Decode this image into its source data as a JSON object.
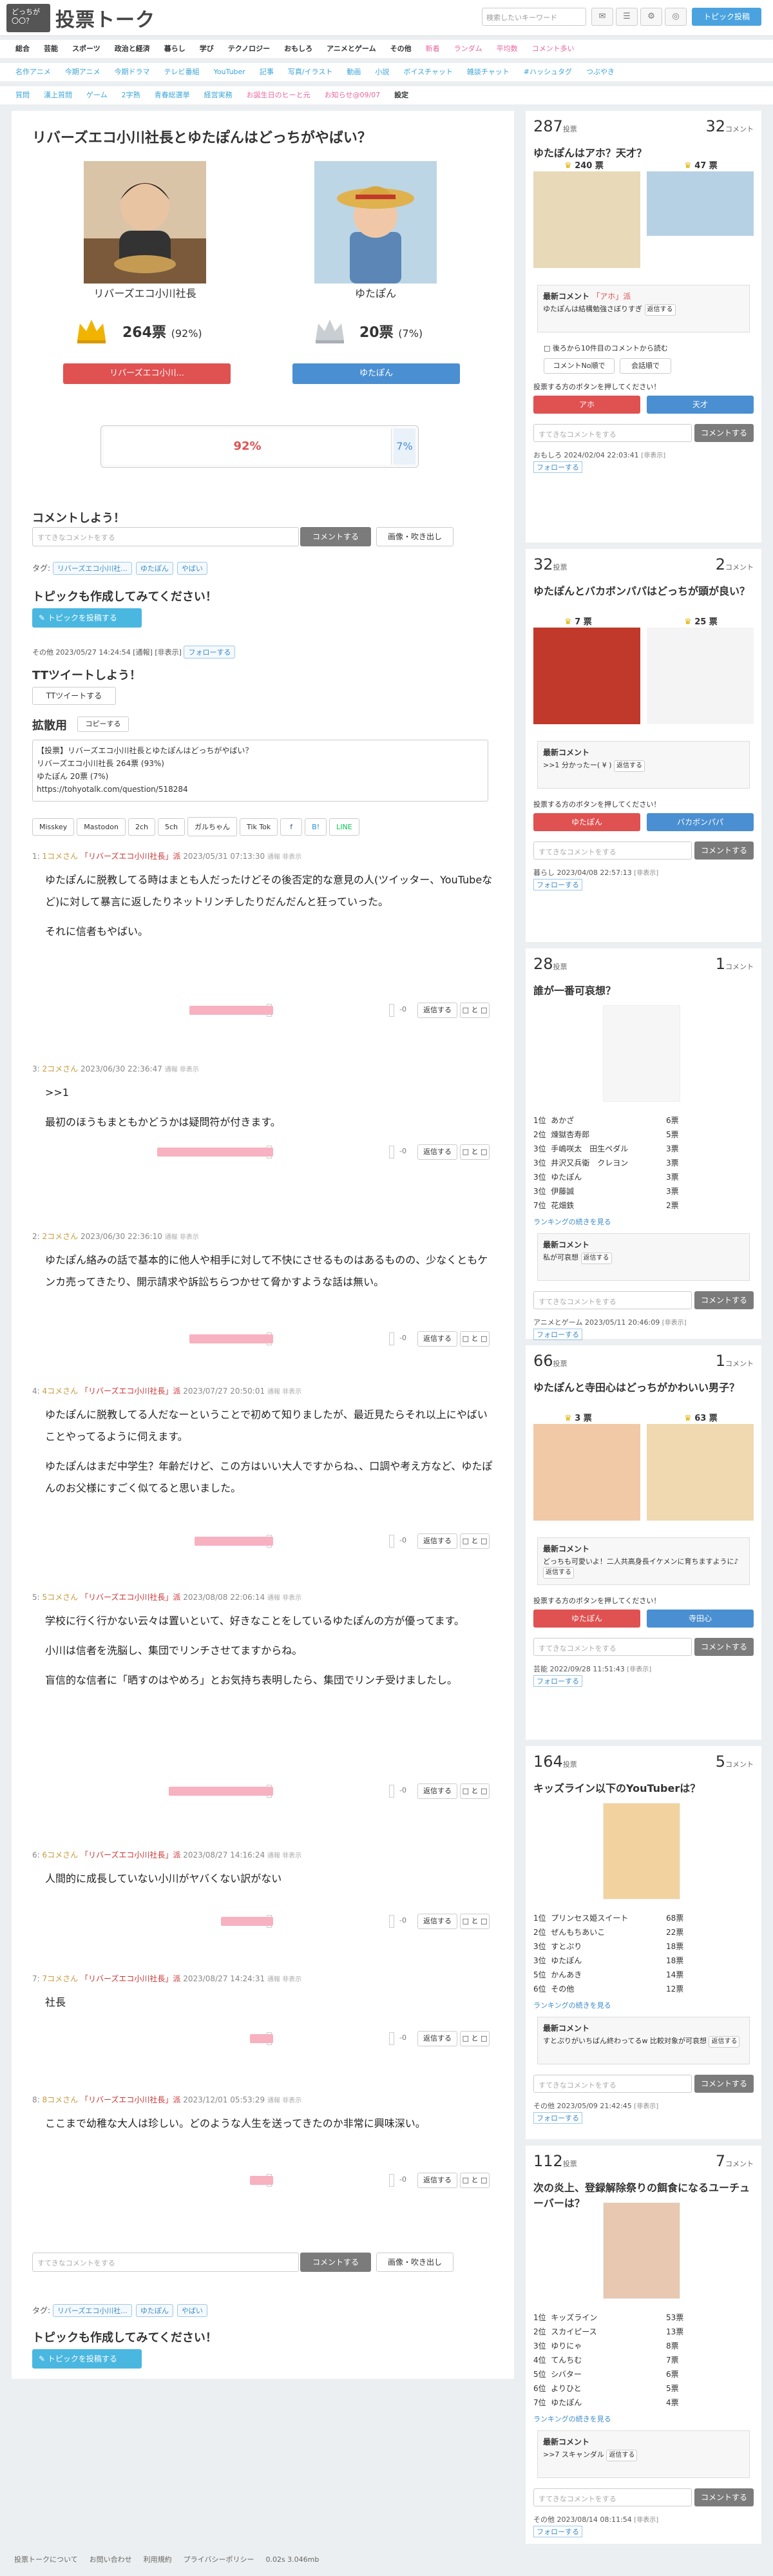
{
  "header": {
    "logo_line1": "どっちが",
    "logo_line2": "〇〇？",
    "logo_text": "投票トーク",
    "search_placeholder": "検索したいキーワード",
    "icon1": "✉",
    "icon2": "☰",
    "icon3": "⚙",
    "icon4": "◎",
    "post_label": "トピック投稿"
  },
  "nav1": [
    "総合",
    "芸能",
    "スポーツ",
    "政治と経済",
    "暮らし",
    "学び",
    "テクノロジー",
    "おもしろ",
    "アニメとゲーム",
    "その他",
    "新着",
    "ランダム",
    "平均数",
    "コメント多い"
  ],
  "nav2": [
    "名作アニメ",
    "今期アニメ",
    "今期ドラマ",
    "テレビ番組",
    "YouTuber",
    "記事",
    "写真/イラスト",
    "動画",
    "小説",
    "ボイスチャット",
    "雑談チャット",
    "#ハッシュタグ",
    "つぶやき"
  ],
  "nav3": [
    "質問",
    "漢上質問",
    "ゲーム",
    "2字熟",
    "青春総選挙",
    "経営実務",
    "お誕生日のヒーと元",
    "お知らせ@09/07",
    "設定"
  ],
  "topic": {
    "title": "リバーズエコ小川社長とゆたぽんはどっちがやばい？",
    "opt_a_name": "リバーズエコ小川社長",
    "opt_b_name": "ゆたぽん",
    "opt_a_votes": "264票",
    "opt_a_pct": "(92%)",
    "opt_b_votes": "20票",
    "opt_b_pct": "(7%)",
    "opt_a_btn": "リバーズエコ小川...",
    "opt_b_btn": "ゆたぽん",
    "bar_a_pct": 92,
    "bar_b_pct": 7,
    "bar_a_label": "92%",
    "bar_b_label": "7%",
    "comment_heading": "コメントしよう！",
    "comment_placeholder": "すてきなコメントをする",
    "comment_btn": "コメントする",
    "image_btn": "画像・吹き出し",
    "tags_label": "タグ:",
    "tags": [
      "リバーズエコ小川社...",
      "ゆたぽん",
      "やばい"
    ],
    "create_heading": "トピックも作成してみてください！",
    "create_btn": "トピックを投稿する",
    "info": "その他  2023/05/27 14:24:54  [通報] [非表示]",
    "follow": "フォローする",
    "tweet_heading": "TTツイートしよう！",
    "tweet_btn": "TTツイートする",
    "spread_heading": "拡散用",
    "copy_btn": "コピーする",
    "spread_text_1": "【投票】リバーズエコ小川社長とゆたぽんはどっちがやばい？",
    "spread_text_2": "リバーズエコ小川社長 264票 (93%)",
    "spread_text_3": "ゆたぽん 20票 (7%)",
    "spread_text_4": "https://tohyotalk.com/question/518284",
    "share": [
      "Misskey",
      "Mastodon",
      "2ch",
      "5ch",
      "ガルちゃん",
      "Tik Tok",
      "",
      "B!",
      "LINE"
    ]
  },
  "comments": [
    {
      "no": "1:",
      "name": "1コメさん",
      "vote": "「リバーズエコ小川社長」派",
      "date": "2023/05/31 07:13:30",
      "small": "通報 非表示",
      "body1": "ゆたぽんに脱教してる時はまとも人だったけどその後否定的な意見の人(ツイッター、YouTubeなど)に対して暴言に返したりネットリンチしたりだんだんと狂っていった。",
      "body2": "それに信者もやばい。",
      "plus": "+18",
      "minus": "-0",
      "pink": 0.72,
      "reply": "返信する",
      "more": "□ と □"
    },
    {
      "no": "3:",
      "name": "2コメさん",
      "vote": "",
      "date": "2023/06/30 22:36:47",
      "small": "通報 非表示",
      "body1": ">>1",
      "body2": "最初のほうもまともかどうかは疑問符が付きます。",
      "plus": "+26",
      "minus": "-0",
      "pink": 1.0,
      "reply": "返信する",
      "more": "□ と □"
    },
    {
      "no": "2:",
      "name": "2コメさん",
      "vote": "",
      "date": "2023/06/30 22:36:10",
      "small": "通報 非表示",
      "body1": "ゆたぽん絡みの話で基本的に他人や相手に対して不快にさせるものはあるものの、少なくともケンカ売ってきたり、開示請求や訴訟ちらつかせて脅かすような話は無い。",
      "body2": "",
      "plus": "+18",
      "minus": "-0",
      "pink": 0.72,
      "reply": "返信する",
      "more": "□ と □"
    },
    {
      "no": "4:",
      "name": "4コメさん",
      "vote": "「リバーズエコ小川社長」派",
      "date": "2023/07/27 20:50:01",
      "small": "通報 非表示",
      "body1": "ゆたぽんに脱教してる人だなーということで初めて知りましたが、最近見たらそれ以上にやばいことやってるように伺えます。",
      "body2": "ゆたぽんはまだ中学生？年齢だけど、この方はいい大人ですからね、、口調や考え方など、ゆたぽんのお父様にすごく似てると思いました。",
      "plus": "+17",
      "minus": "-0",
      "pink": 0.68,
      "reply": "返信する",
      "more": "□ と □"
    },
    {
      "no": "5:",
      "name": "5コメさん",
      "vote": "「リバーズエコ小川社長」派",
      "date": "2023/08/08 22:06:14",
      "small": "通報 非表示",
      "body1": "学校に行く行かない云々は置いといて、好きなことをしているゆたぽんの方が優ってます。",
      "body2": "小川は信者を洗脳し、集団でリンチさせてますからね。",
      "body3": "盲信的な信者に「晒すのはやめろ」とお気持ち表明したら、集団でリンチ受けましたし。",
      "plus": "+22",
      "minus": "-0",
      "pink": 0.9,
      "reply": "返信する",
      "more": "□ と □"
    },
    {
      "no": "6:",
      "name": "6コメさん",
      "vote": "「リバーズエコ小川社長」派",
      "date": "2023/08/27 14:16:24",
      "small": "通報 非表示",
      "body1": "人間的に成長していない小川がヤバくない訳がない",
      "body2": "",
      "plus": "+11",
      "minus": "-0",
      "pink": 0.45,
      "reply": "返信する",
      "more": "□ と □"
    },
    {
      "no": "7:",
      "name": "7コメさん",
      "vote": "「リバーズエコ小川社長」派",
      "date": "2023/08/27 14:24:31",
      "small": "通報 非表示",
      "body1": "社長",
      "body2": "",
      "plus": "+5",
      "minus": "-0",
      "pink": 0.2,
      "reply": "返信する",
      "more": "□ と □"
    },
    {
      "no": "8:",
      "name": "8コメさん",
      "vote": "「リバーズエコ小川社長」派",
      "date": "2023/12/01 05:53:29",
      "small": "通報 非表示",
      "body1": "ここまで幼稚な大人は珍しい。どのような人生を送ってきたのか非常に興味深い。",
      "body2": "",
      "plus": "+5",
      "minus": "-0",
      "pink": 0.2,
      "reply": "返信する",
      "more": "□ と □"
    }
  ],
  "bottom": {
    "comment_placeholder": "すてきなコメントをする",
    "comment_btn": "コメントする",
    "image_btn": "画像・吹き出し",
    "tags_label": "タグ:",
    "tags": [
      "リバーズエコ小川社...",
      "ゆたぽん",
      "やばい"
    ],
    "create_heading": "トピックも作成してみてください！",
    "create_btn": "トピックを投稿する"
  },
  "sidebar": [
    {
      "votes": "287",
      "votes_unit": "投票",
      "comments": "32",
      "comments_unit": "コメント",
      "title": "ゆたぽんはアホ？天才？",
      "a_votes": "240 票",
      "b_votes": "47 票",
      "latest_label": "最新コメント",
      "latest_vote": "「アホ」派",
      "latest_text": "ゆたぽんは結構勉強さぼりすぎ",
      "reply": "返信する",
      "check_label": "後ろから10件目のコメントから読む",
      "c_btn": "コメントNo順で",
      "c_btn2": "会話順で",
      "prompt": "投票する方のボタンを押してください！",
      "btn_a": "アホ",
      "btn_b": "天才",
      "input": "すてきなコメントをする",
      "cbtn": "コメントする",
      "info": "おもしろ  2024/02/04 22:03:41",
      "follow": "フォローする"
    },
    {
      "votes": "32",
      "votes_unit": "投票",
      "comments": "2",
      "comments_unit": "コメント",
      "title": "ゆたぽんとバカボンパパはどっちが頭が良い？",
      "a_votes": "7 票",
      "b_votes": "25 票",
      "latest_label": "最新コメント",
      "latest_text": ">>1 分かったー( ¥ )",
      "reply": "返信する",
      "prompt": "投票する方のボタンを押してください！",
      "btn_a": "ゆたぽん",
      "btn_b": "バカボンパパ",
      "input": "すてきなコメントをする",
      "cbtn": "コメントする",
      "info": "暮らし  2023/04/08 22:57:13",
      "follow": "フォローする"
    },
    {
      "votes": "28",
      "votes_unit": "投票",
      "comments": "1",
      "comments_unit": "コメント",
      "title": "誰が一番可哀想？",
      "ranks": [
        [
          "1位",
          "あかざ",
          "6票"
        ],
        [
          "2位",
          "煉獄杏寿郎",
          "5票"
        ],
        [
          "3位",
          "手嶋咲太　田生ペダル",
          "3票"
        ],
        [
          "3位",
          "井沢又兵衛　クレヨン",
          "3票"
        ],
        [
          "3位",
          "ゆたぽん",
          "3票"
        ],
        [
          "3位",
          "伊藤誠",
          "3票"
        ],
        [
          "7位",
          "花畑鉄",
          "2票"
        ]
      ],
      "more": "ランキングの続きを見る",
      "latest_label": "最新コメント",
      "latest_text": "私が可哀想",
      "reply": "返信する",
      "input": "すてきなコメントをする",
      "cbtn": "コメントする",
      "info": "アニメとゲーム  2023/05/11 20:46:09",
      "follow": "フォローする"
    },
    {
      "votes": "66",
      "votes_unit": "投票",
      "comments": "1",
      "comments_unit": "コメント",
      "title": "ゆたぽんと寺田心はどっちがかわいい男子？",
      "a_votes": "3 票",
      "b_votes": "63 票",
      "latest_label": "最新コメント",
      "latest_text": "どっちも可愛いよ！二人共高身長イケメンに育ちますように♪",
      "reply": "返信する",
      "prompt": "投票する方のボタンを押してください！",
      "btn_a": "ゆたぽん",
      "btn_b": "寺田心",
      "input": "すてきなコメントをする",
      "cbtn": "コメントする",
      "info": "芸能  2022/09/28 11:51:43",
      "follow": "フォローする"
    },
    {
      "votes": "164",
      "votes_unit": "投票",
      "comments": "5",
      "comments_unit": "コメント",
      "title": "キッズライン以下のYouTuberは？",
      "ranks": [
        [
          "1位",
          "プリンセス姫スイート",
          "68票"
        ],
        [
          "2位",
          "ぜんもちあいこ",
          "22票"
        ],
        [
          "3位",
          "すとぷり",
          "18票"
        ],
        [
          "3位",
          "ゆたぽん",
          "18票"
        ],
        [
          "5位",
          "かんあき",
          "14票"
        ],
        [
          "6位",
          "その他",
          "12票"
        ]
      ],
      "more": "ランキングの続きを見る",
      "latest_label": "最新コメント",
      "latest_text": "すとぷりがいちばん終わってるw 比較対象が可哀想",
      "reply": "返信する",
      "input": "すてきなコメントをする",
      "cbtn": "コメントする",
      "info": "その他  2023/05/09 21:42:45",
      "follow": "フォローする"
    },
    {
      "votes": "112",
      "votes_unit": "投票",
      "comments": "7",
      "comments_unit": "コメント",
      "title": "次の炎上、登録解除祭りの餌食になるユーチューバーは？",
      "ranks": [
        [
          "1位",
          "キッズライン",
          "53票"
        ],
        [
          "2位",
          "スカイピース",
          "13票"
        ],
        [
          "3位",
          "ゆりにゃ",
          "8票"
        ],
        [
          "4位",
          "てんちむ",
          "7票"
        ],
        [
          "5位",
          "シバター",
          "6票"
        ],
        [
          "6位",
          "よりひと",
          "5票"
        ],
        [
          "7位",
          "ゆたぽん",
          "4票"
        ]
      ],
      "more": "ランキングの続きを見る",
      "latest_label": "最新コメント",
      "latest_text": ">>7 スキャンダル",
      "reply": "返信する",
      "input": "すてきなコメントをする",
      "cbtn": "コメントする",
      "info": "その他  2023/08/14 08:11:54",
      "follow": "フォローする"
    }
  ],
  "footer": [
    "投票トークについて",
    "お問い合わせ",
    "利用規約",
    "プライバシーポリシー",
    "0.02s 3.046mb"
  ]
}
